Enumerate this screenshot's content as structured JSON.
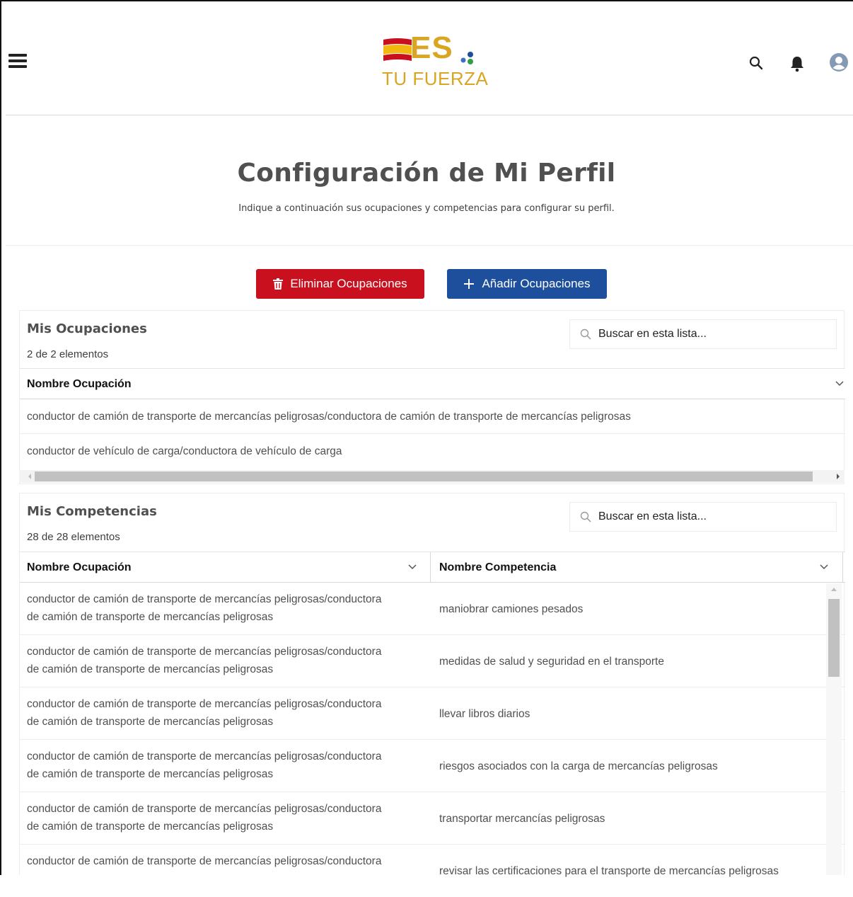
{
  "header": {
    "logo_text": "ES",
    "logo_tagline": "TU FUERZA",
    "icons": [
      "menu-icon",
      "search-icon",
      "bell-icon",
      "user-avatar-icon"
    ]
  },
  "page": {
    "title": "Configuración de Mi Perfil",
    "subtitle": "Indique a continuación sus ocupaciones y competencias para configurar su perfil."
  },
  "buttons": {
    "delete_label": "Eliminar Ocupaciones",
    "add_label": "Añadir Ocupaciones"
  },
  "colors": {
    "delete": "#c8101e",
    "add": "#1e4f9c",
    "logo_gold": "#d9a623"
  },
  "occupations": {
    "title": "Mis Ocupaciones",
    "count": "2 de 2 elementos",
    "search_placeholder": "Buscar en esta lista...",
    "column": "Nombre Ocupación",
    "rows": [
      "conductor de camión de transporte de mercancías peligrosas/conductora de camión de transporte de mercancías peligrosas",
      "conductor de vehículo de carga/conductora de vehículo de carga"
    ]
  },
  "competencies": {
    "title": "Mis Competencias",
    "count": "28 de 28 elementos",
    "search_placeholder": "Buscar en esta lista...",
    "columns": [
      "Nombre Ocupación",
      "Nombre Competencia"
    ],
    "rows": [
      {
        "occupation_line1": "conductor de camión de transporte de mercancías peligrosas/conductora",
        "occupation_line2": "de camión de transporte de mercancías peligrosas",
        "competency": "maniobrar camiones pesados"
      },
      {
        "occupation_line1": "conductor de camión de transporte de mercancías peligrosas/conductora",
        "occupation_line2": "de camión de transporte de mercancías peligrosas",
        "competency": "medidas de salud y seguridad en el transporte"
      },
      {
        "occupation_line1": "conductor de camión de transporte de mercancías peligrosas/conductora",
        "occupation_line2": "de camión de transporte de mercancías peligrosas",
        "competency": "llevar libros diarios"
      },
      {
        "occupation_line1": "conductor de camión de transporte de mercancías peligrosas/conductora",
        "occupation_line2": "de camión de transporte de mercancías peligrosas",
        "competency": "riesgos asociados con la carga de mercancías peligrosas"
      },
      {
        "occupation_line1": "conductor de camión de transporte de mercancías peligrosas/conductora",
        "occupation_line2": "de camión de transporte de mercancías peligrosas",
        "competency": "transportar mercancías peligrosas"
      },
      {
        "occupation_line1": "conductor de camión de transporte de mercancías peligrosas/conductora",
        "occupation_line2": "",
        "competency": "revisar las certificaciones para el transporte de mercancías peligrosas"
      }
    ]
  }
}
